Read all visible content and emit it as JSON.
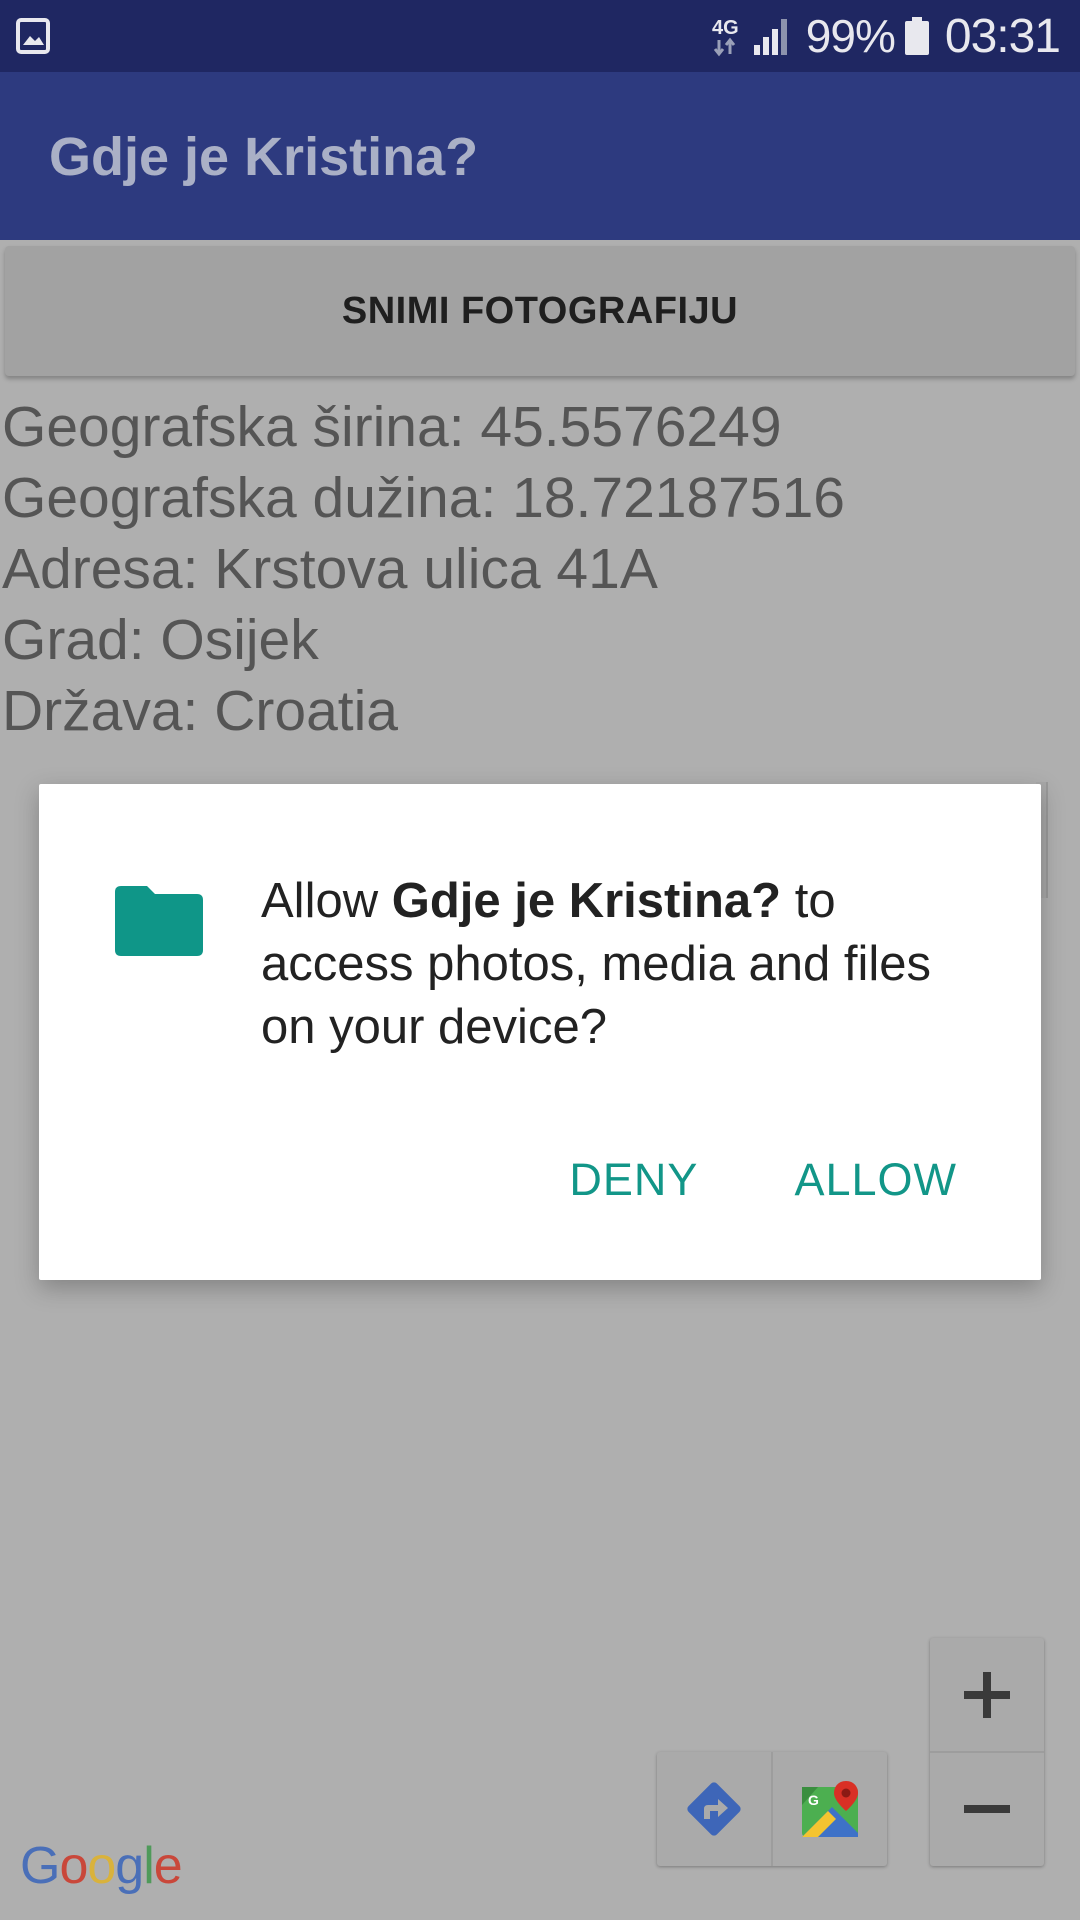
{
  "status_bar": {
    "network": "4G",
    "battery_percent": "99%",
    "time": "03:31",
    "icons": [
      "gallery-icon",
      "network-4g-icon",
      "signal-icon",
      "battery-icon"
    ]
  },
  "app_bar": {
    "title": "Gdje je Kristina?"
  },
  "main": {
    "snap_button_label": "SNIMI FOTOGRAFIJU",
    "info_lines": [
      "Geografska širina: 45.5576249",
      "Geografska dužina: 18.72187516",
      "Adresa: Krstova ulica 41A",
      "Grad: Osijek",
      "Država: Croatia"
    ]
  },
  "map": {
    "attribution": "Google",
    "controls": [
      "zoom-in-icon",
      "zoom-out-icon",
      "directions-icon",
      "google-maps-icon"
    ]
  },
  "dialog": {
    "message_prefix": "Allow ",
    "app_name": "Gdje je Kristina?",
    "message_suffix": " to access photos, media and files on your device?",
    "deny_label": "DENY",
    "allow_label": "ALLOW",
    "accent_color": "#129688"
  },
  "colors": {
    "status_bar": "#1f2762",
    "app_bar": "#2d3a7f",
    "scrim_background": "#afafaf",
    "dialog_accent": "#129688"
  }
}
